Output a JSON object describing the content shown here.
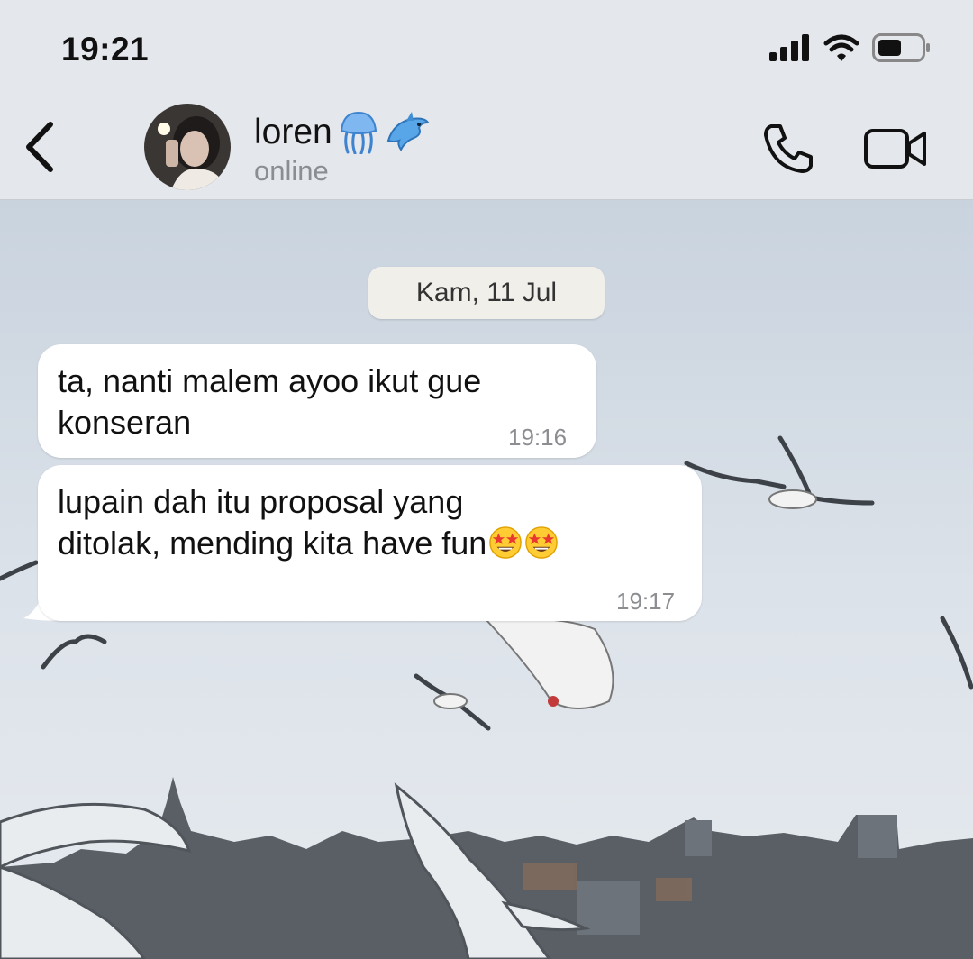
{
  "status_bar": {
    "time": "19:21"
  },
  "header": {
    "contact_name": "loren",
    "contact_emojis": [
      "jellyfish-emoji",
      "dolphin-emoji"
    ],
    "contact_status": "online"
  },
  "chat": {
    "date_label": "Kam, 11 Jul",
    "messages": [
      {
        "text": "ta, nanti malem ayoo ikut gue\nkonseran",
        "time": "19:16"
      },
      {
        "text": "lupain dah itu proposal yang\nditolak, mending kita have fun",
        "emojis": [
          "star-struck-emoji",
          "star-struck-emoji"
        ],
        "time": "19:17"
      }
    ]
  },
  "colors": {
    "bubble": "#ffffff",
    "header_bg": "#e4e7eb",
    "date_chip": "#f1efea"
  }
}
